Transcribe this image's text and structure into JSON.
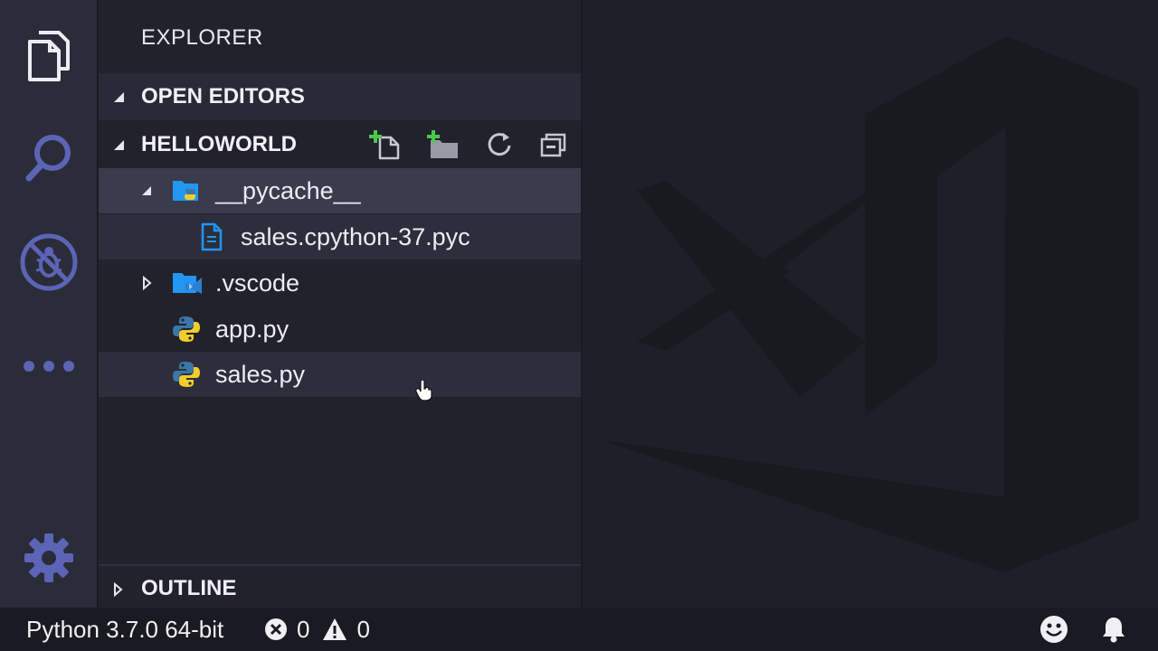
{
  "sidebar": {
    "title": "EXPLORER",
    "sections": {
      "open_editors": "OPEN EDITORS",
      "workspace": "HELLOWORLD",
      "outline": "OUTLINE"
    },
    "tree": [
      {
        "label": "__pycache__",
        "icon": "python-folder-icon",
        "expanded": true
      },
      {
        "label": "sales.cpython-37.pyc",
        "icon": "file-icon"
      },
      {
        "label": ".vscode",
        "icon": "vscode-folder-icon",
        "expanded": false
      },
      {
        "label": "app.py",
        "icon": "python-icon"
      },
      {
        "label": "sales.py",
        "icon": "python-icon"
      }
    ]
  },
  "status": {
    "interpreter": "Python 3.7.0 64-bit",
    "errors": "0",
    "warnings": "0"
  },
  "colors": {
    "activity_bar": "#2b2c3a",
    "accent_icon": "#5b64b5",
    "sidebar": "#22222d",
    "selection": "#3a3b4d",
    "python_blue": "#3b77a8",
    "python_yellow": "#f2cd2b",
    "folder_blue": "#2196f3"
  }
}
